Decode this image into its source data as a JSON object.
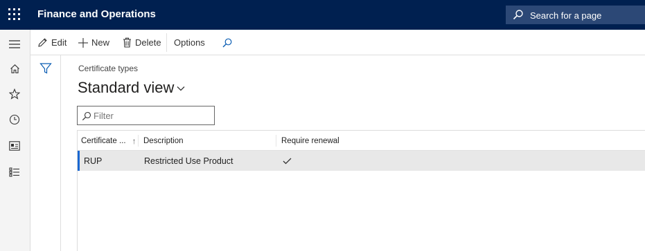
{
  "app": {
    "title": "Finance and Operations"
  },
  "search": {
    "placeholder": "Search for a page"
  },
  "navbar": {
    "items": [
      {
        "icon": "hamburger-icon"
      },
      {
        "icon": "home-icon"
      },
      {
        "icon": "star-icon"
      },
      {
        "icon": "clock-icon"
      },
      {
        "icon": "workspace-icon"
      },
      {
        "icon": "list-icon"
      }
    ]
  },
  "actions": {
    "edit": "Edit",
    "new": "New",
    "delete": "Delete",
    "options": "Options"
  },
  "page": {
    "caption": "Certificate types",
    "view_title": "Standard view",
    "filter_placeholder": "Filter"
  },
  "grid": {
    "columns": [
      "Certificate ...",
      "Description",
      "Require renewal"
    ],
    "sort_indicator": "↑",
    "rows": [
      {
        "certificate_type": "RUP",
        "description": "Restricted Use Product",
        "require_renewal": true
      }
    ]
  },
  "colors": {
    "topbar": "#002050",
    "search_box": "#2c4876",
    "selected_row": "#e8e8e8",
    "row_marker": "#1967d2",
    "icon_blue": "#0a5db3"
  }
}
